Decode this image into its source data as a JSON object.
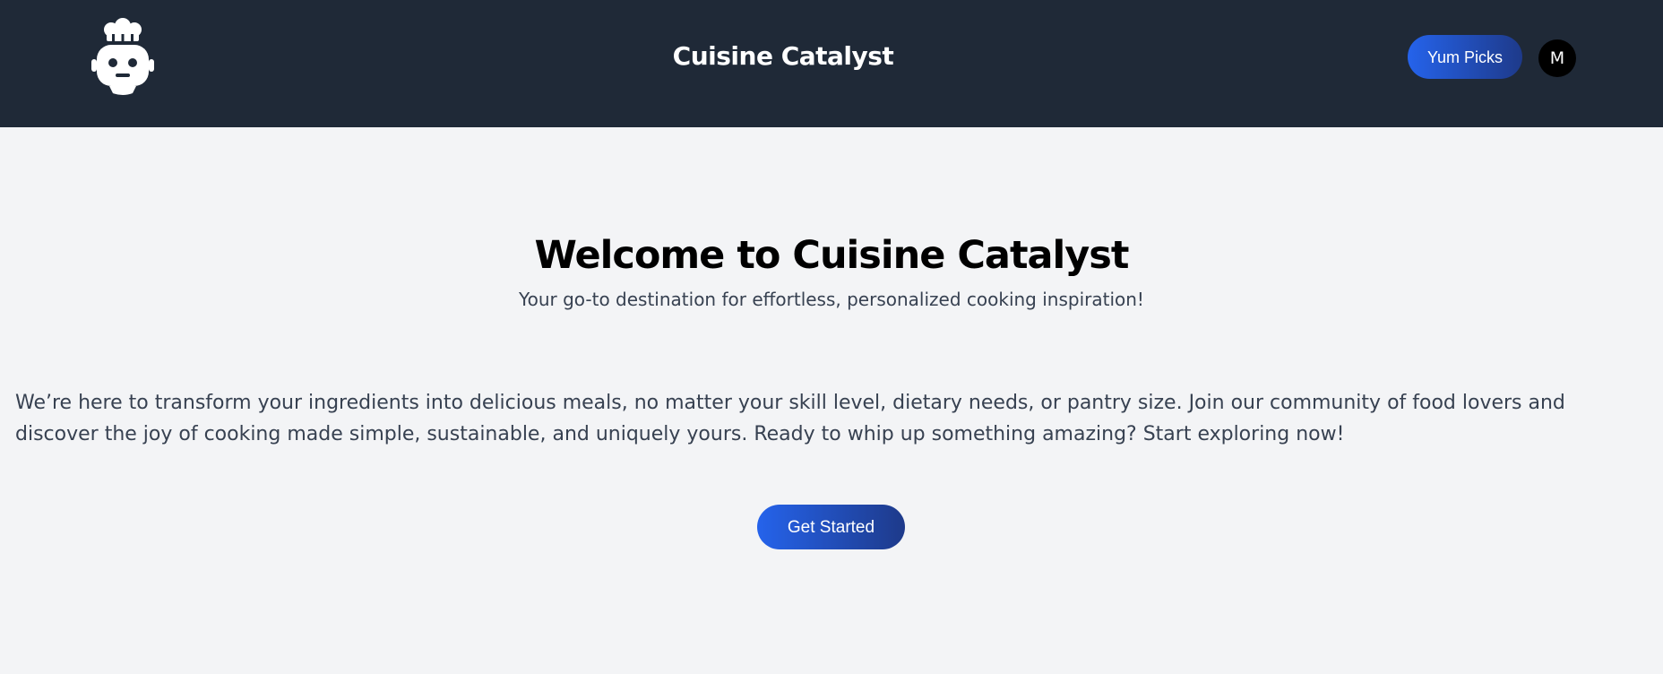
{
  "header": {
    "logo_icon": "chef-robot-icon",
    "title": "Cuisine Catalyst",
    "nav_button_label": "Yum Picks",
    "avatar_initial": "M",
    "background_color": "#1f2937"
  },
  "hero": {
    "title": "Welcome to Cuisine Catalyst",
    "subtitle": "Your go-to destination for effortless, personalized cooking inspiration!",
    "body": "We’re here to transform your ingredients into delicious meals, no matter your skill level, dietary needs, or pantry size. Join our community of food lovers and discover the joy of cooking made simple, sustainable, and uniquely yours. Ready to whip up something amazing? Start exploring now!",
    "cta_label": "Get Started"
  },
  "colors": {
    "accent_start": "#2563eb",
    "accent_end": "#1e3a8a",
    "page_background": "#f3f4f6"
  }
}
